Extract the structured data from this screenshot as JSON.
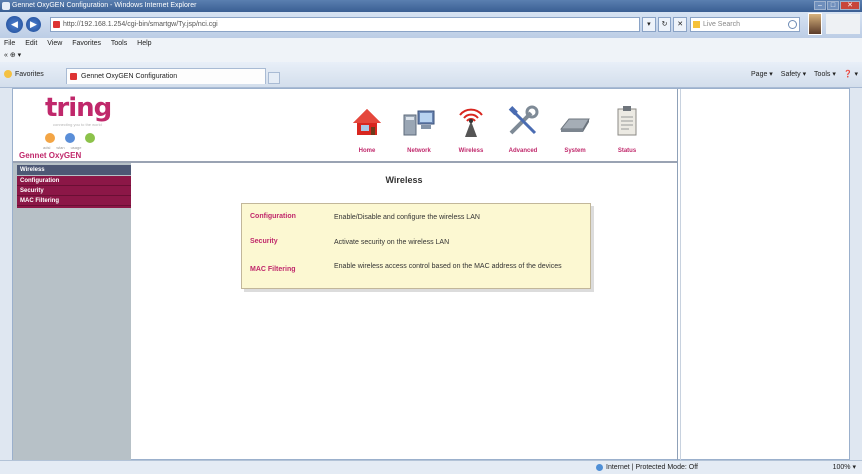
{
  "window": {
    "title": "Gennet OxyGEN Configuration - Windows Internet Explorer",
    "controls": {
      "minimize": "–",
      "maximize": "□",
      "close": "✕"
    }
  },
  "browser": {
    "address": "http://192.168.1.254/cgi-bin/smartgw/Ty.jsp/nci.cgi",
    "back": "◀",
    "forward": "▶",
    "address_tools": [
      "▾",
      "↻",
      "✕"
    ],
    "search_placeholder": "Live Search",
    "menu": [
      "File",
      "Edit",
      "View",
      "Favorites",
      "Tools",
      "Help"
    ],
    "links": "« ⊕ ▾",
    "favorites_label": "Favorites",
    "tab_title": "Gennet OxyGEN Configuration",
    "commands": [
      "Page ▾",
      "Safety ▾",
      "Tools ▾",
      "❓ ▾"
    ],
    "status": {
      "zone": "Internet | Protected Mode: Off",
      "zoom": "100% ▾"
    }
  },
  "router": {
    "logo": "tring",
    "logo_tagline": "connecting you to the world",
    "status_dots": [
      {
        "label": "adsl",
        "color": "#f3a545"
      },
      {
        "label": "wlan",
        "color": "#5a8ed8"
      },
      {
        "label": "usage",
        "color": "#8cc24a"
      }
    ],
    "product_name": "Gennet OxyGEN",
    "nav": [
      {
        "label": "Home",
        "icon": "home-icon"
      },
      {
        "label": "Network",
        "icon": "network-icon"
      },
      {
        "label": "Wireless",
        "icon": "wireless-icon"
      },
      {
        "label": "Advanced",
        "icon": "tools-icon"
      },
      {
        "label": "System",
        "icon": "system-icon"
      },
      {
        "label": "Status",
        "icon": "status-icon"
      }
    ],
    "sidebar": {
      "header": "Wireless",
      "items": [
        "Configuration",
        "Security",
        "MAC Filtering"
      ]
    },
    "page_title": "Wireless",
    "entries": [
      {
        "link": "Configuration",
        "desc": "Enable/Disable and configure the wireless LAN"
      },
      {
        "link": "Security",
        "desc": "Activate security on the wireless LAN"
      },
      {
        "link": "MAC Filtering",
        "desc": "Enable wireless access control based on the MAC address of the devices"
      }
    ]
  },
  "colors": {
    "brand": "#c0286b",
    "sidebar_item": "#8c1747",
    "sidebar_header": "#4d5875",
    "infobox_bg": "#fcf8d2"
  }
}
